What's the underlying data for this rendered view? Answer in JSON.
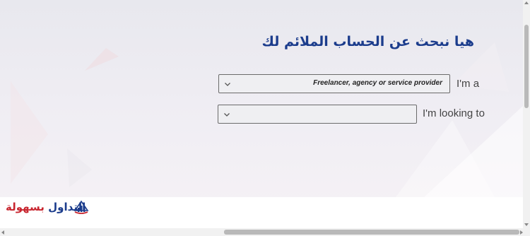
{
  "page": {
    "heading": "هيا نبحث عن الحساب الملائم لك"
  },
  "form": {
    "role": {
      "label": "I'm a",
      "selected_value": "Freelancer, agency or service provider"
    },
    "looking_for": {
      "label": "I'm looking to",
      "selected_value": ""
    }
  },
  "footer": {
    "logo_word_red": "بسهولة",
    "logo_word_blue": "التداول"
  },
  "colors": {
    "heading": "#1b3c8c",
    "logo_red": "#c8262f",
    "logo_blue": "#1b3c8c",
    "select_border": "#6b6b6b"
  },
  "icons": {
    "dropdown": "chevron-down-icon",
    "logo": "bar-chart-logo-icon"
  }
}
